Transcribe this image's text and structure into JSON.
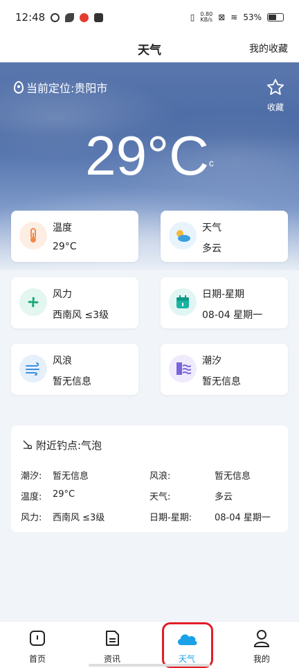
{
  "status": {
    "time": "12:48",
    "speed_top": "0.80",
    "speed_bottom": "KB/s",
    "battery": "53%"
  },
  "header": {
    "title": "天气",
    "favorites_link": "我的收藏"
  },
  "hero": {
    "location": "当前定位:贵阳市",
    "favorite_label": "收藏",
    "temperature": "29°C",
    "unit_small": "c"
  },
  "cards": [
    {
      "label": "温度",
      "value": "29°C",
      "icon": "thermometer-icon"
    },
    {
      "label": "天气",
      "value": "多云",
      "icon": "partly-cloudy-icon"
    },
    {
      "label": "风力",
      "value": "西南风 ≤3级",
      "icon": "fan-icon"
    },
    {
      "label": "日期-星期",
      "value": "08-04 星期一",
      "icon": "calendar-icon"
    },
    {
      "label": "风浪",
      "value": "暂无信息",
      "icon": "wind-wave-icon"
    },
    {
      "label": "潮汐",
      "value": "暂无信息",
      "icon": "tide-icon"
    }
  ],
  "nearby": {
    "title": "附近钓点:气泡",
    "rows": [
      {
        "k1": "潮汐:",
        "v1": "暂无信息",
        "k2": "风浪:",
        "v2": "暂无信息"
      },
      {
        "k1": "温度:",
        "v1": "29°C",
        "k2": "天气:",
        "v2": "多云"
      },
      {
        "k1": "风力:",
        "v1": "西南风 ≤3级",
        "k2": "日期-星期:",
        "v2": "08-04 星期一"
      }
    ]
  },
  "tabs": [
    {
      "label": "首页",
      "icon": "home-icon"
    },
    {
      "label": "资讯",
      "icon": "document-icon"
    },
    {
      "label": "天气",
      "icon": "cloud-icon"
    },
    {
      "label": "我的",
      "icon": "user-icon"
    }
  ],
  "colors": {
    "accent": "#1aa1e8",
    "highlight": "#e11d2a"
  }
}
